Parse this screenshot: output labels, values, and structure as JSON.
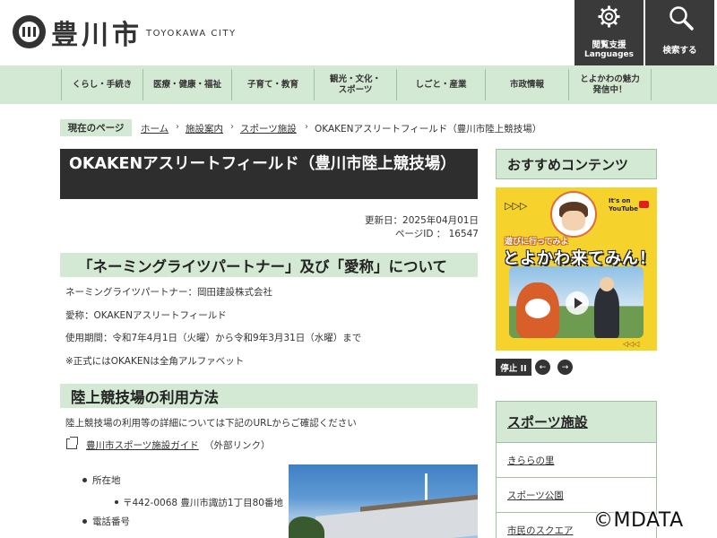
{
  "header": {
    "site_name": "豊川市",
    "site_name_en": "TOYOKAWA CITY",
    "language_button": {
      "line1": "閲覧支援",
      "line2": "Languages",
      "icon": "gear-icon"
    },
    "search_button": {
      "label": "検索する",
      "icon": "search-icon"
    }
  },
  "nav": {
    "items": [
      {
        "label": "くらし・手続き"
      },
      {
        "label": "医療・健康・福祉"
      },
      {
        "label": "子育て・教育"
      },
      {
        "label": "観光・文化・\nスポーツ"
      },
      {
        "label": "しごと・産業"
      },
      {
        "label": "市政情報"
      },
      {
        "label": "とよかわの魅力\n発信中！"
      }
    ]
  },
  "breadcrumb": {
    "label": "現在のページ",
    "links": [
      "ホーム",
      "施設案内",
      "スポーツ施設"
    ],
    "current": "OKAKENアスリートフィールド（豊川市陸上競技場）"
  },
  "page": {
    "title": "OKAKENアスリートフィールド（豊川市陸上競技場）",
    "updated": "更新日：2025年04月01日",
    "page_id": "ページID ： 16547"
  },
  "section1": {
    "heading": "「ネーミングライツパートナー」及び「愛称」について",
    "lines": [
      "ネーミングライツパートナー：岡田建設株式会社",
      "愛称：OKAKENアスリートフィールド",
      "使用期間：令和7年4月1日（火曜）から令和9年3月31日（水曜）まで",
      "※正式にはOKAKENは全角アルファベット"
    ]
  },
  "section2": {
    "heading": "陸上競技場の利用方法",
    "intro": "陸上競技場の利用等の詳細については下記のURLからご確認ください",
    "link_label": "豊川市スポーツ施設ガイド",
    "link_note": "（外部リンク）",
    "location_label": "所在地",
    "address": "〒442-0068  豊川市諏訪1丁目80番地",
    "phone_label": "電話番号"
  },
  "sidebar": {
    "recommended_heading": "おすすめコンテンツ",
    "banner": {
      "youtube_line1": "It's on",
      "youtube_line2": "YouTube",
      "subtitle": "遊びに行ってみよ",
      "title": "とよかわ来てみん！"
    },
    "stop_label": "停止 II",
    "prev_label": "←",
    "next_label": "→",
    "sports_heading": "スポーツ施設",
    "sports_items": [
      "きららの里",
      "スポーツ公園",
      "市民のスクエア"
    ]
  },
  "watermark": "©MDATA",
  "colors": {
    "nav_bg": "#d4e9d4",
    "title_bg": "#2e2e2e",
    "header_button_bg": "#3a3a3a",
    "banner_yellow": "#f6d22c"
  }
}
